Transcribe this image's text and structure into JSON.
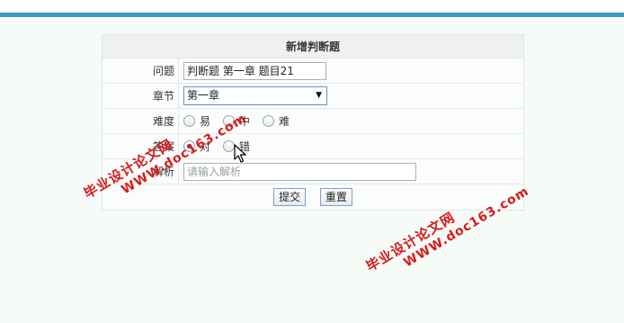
{
  "form": {
    "title": "新增判断题",
    "question": {
      "label": "问题",
      "value": "判断题 第一章 题目21"
    },
    "chapter": {
      "label": "章节",
      "selected": "第一章"
    },
    "difficulty": {
      "label": "难度",
      "options": [
        "易",
        "中",
        "难"
      ]
    },
    "answer": {
      "label": "答案",
      "options": [
        "对",
        "错"
      ],
      "selected": "对"
    },
    "analysis": {
      "label": "解析",
      "placeholder": "请输入解析"
    },
    "buttons": {
      "submit": "提交",
      "reset": "重置"
    }
  },
  "watermarks": [
    {
      "site": "毕业设计论文网",
      "url": "WWW.doc163.com"
    },
    {
      "site": "毕业设计论文网",
      "url": "WWW.doc163.com"
    }
  ],
  "colors": {
    "accent_bar": "#3e9bbb",
    "watermark": "#d61c1c",
    "button_border": "#7d9ec6"
  },
  "icons": {
    "cursor": "mouse-pointer-icon",
    "select_arrow": "caret-down-icon"
  }
}
